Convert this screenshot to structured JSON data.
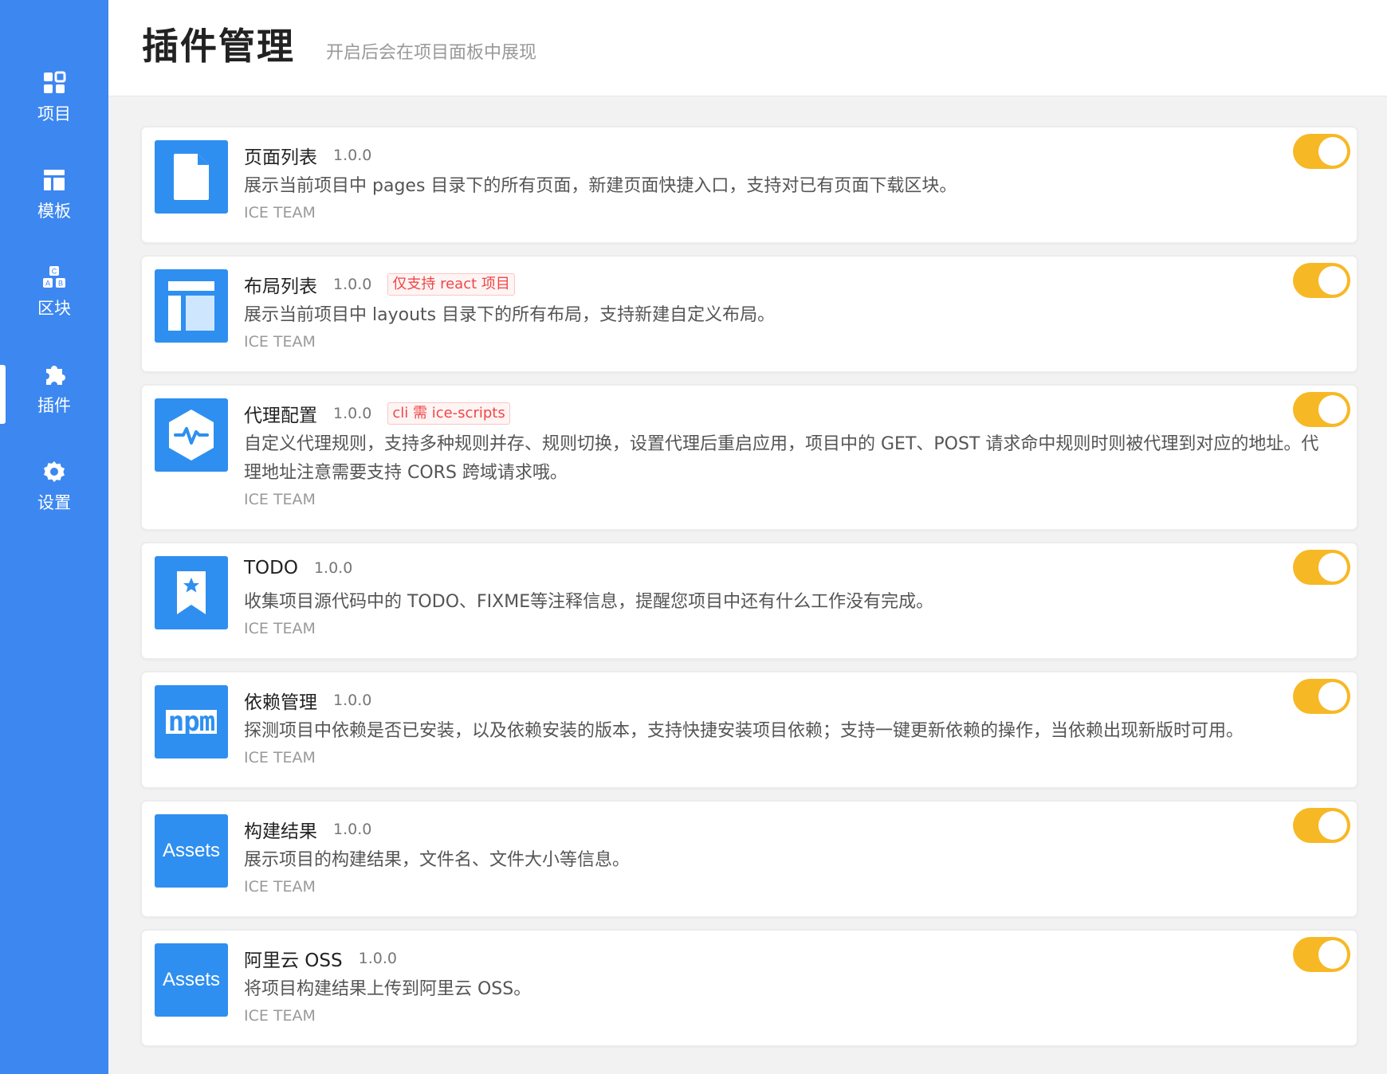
{
  "sidebar": {
    "items": [
      {
        "label": "项目",
        "icon": "dashboard-icon"
      },
      {
        "label": "模板",
        "icon": "layout-icon"
      },
      {
        "label": "区块",
        "icon": "blocks-icon"
      },
      {
        "label": "插件",
        "icon": "puzzle-icon",
        "active": true
      },
      {
        "label": "设置",
        "icon": "gear-icon"
      }
    ]
  },
  "header": {
    "title": "插件管理",
    "subtitle": "开启后会在项目面板中展现"
  },
  "colors": {
    "sidebar_bg": "#3d87f0",
    "icon_bg": "#2e8ff0",
    "toggle_on": "#f7b825",
    "tag_red": "#f04646"
  },
  "plugins": [
    {
      "name": "页面列表",
      "version": "1.0.0",
      "tag": "",
      "description": "展示当前项目中 pages 目录下的所有页面，新建页面快捷入口，支持对已有页面下载区块。",
      "author": "ICE TEAM",
      "icon": "page-icon",
      "enabled": true
    },
    {
      "name": "布局列表",
      "version": "1.0.0",
      "tag": "仅支持 react 项目",
      "description": "展示当前项目中 layouts 目录下的所有布局，支持新建自定义布局。",
      "author": "ICE TEAM",
      "icon": "layout-icon",
      "enabled": true
    },
    {
      "name": "代理配置",
      "version": "1.0.0",
      "tag": "cli 需 ice-scripts",
      "description": "自定义代理规则，支持多种规则并存、规则切换，设置代理后重启应用，项目中的 GET、POST 请求命中规则时则被代理到对应的地址。代理地址注意需要支持 CORS 跨域请求哦。",
      "author": "ICE TEAM",
      "icon": "proxy-icon",
      "enabled": true
    },
    {
      "name": "TODO",
      "version": "1.0.0",
      "tag": "",
      "description": "收集项目源代码中的 TODO、FIXME等注释信息，提醒您项目中还有什么工作没有完成。",
      "author": "ICE TEAM",
      "icon": "bookmark-icon",
      "enabled": true
    },
    {
      "name": "依赖管理",
      "version": "1.0.0",
      "tag": "",
      "description": "探测项目中依赖是否已安装，以及依赖安装的版本，支持快捷安装项目依赖；支持一键更新依赖的操作，当依赖出现新版时可用。",
      "author": "ICE TEAM",
      "icon": "npm-icon",
      "icon_text": "npm",
      "enabled": true
    },
    {
      "name": "构建结果",
      "version": "1.0.0",
      "tag": "",
      "description": "展示项目的构建结果，文件名、文件大小等信息。",
      "author": "ICE TEAM",
      "icon": "assets-icon",
      "icon_text": "Assets",
      "enabled": true
    },
    {
      "name": "阿里云 OSS",
      "version": "1.0.0",
      "tag": "",
      "description": "将项目构建结果上传到阿里云 OSS。",
      "author": "ICE TEAM",
      "icon": "assets-icon",
      "icon_text": "Assets",
      "enabled": true
    }
  ]
}
